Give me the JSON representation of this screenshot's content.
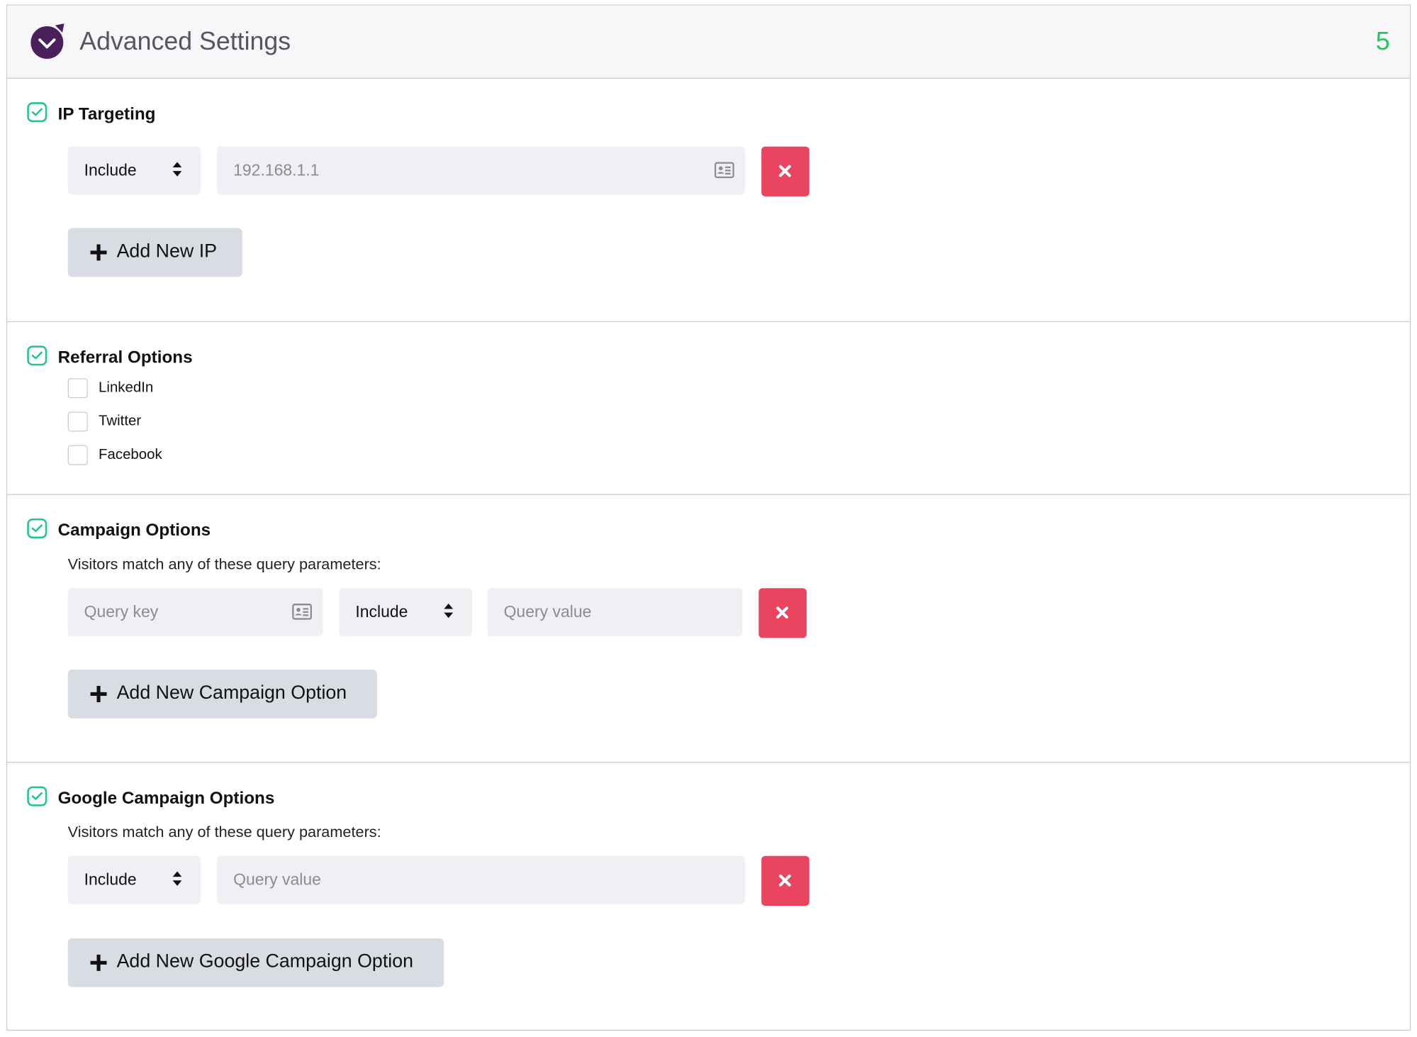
{
  "header": {
    "title": "Advanced Settings",
    "step_number": "5",
    "accent_color": "#22c55e",
    "logo_color": "#4a1f5c"
  },
  "ip_targeting": {
    "title": "IP Targeting",
    "enabled": true,
    "mode": "Include",
    "ip_placeholder": "192.168.1.1",
    "ip_value": "",
    "add_label": "Add New IP"
  },
  "referral": {
    "title": "Referral Options",
    "enabled": true,
    "options": [
      {
        "label": "LinkedIn",
        "checked": false
      },
      {
        "label": "Twitter",
        "checked": false
      },
      {
        "label": "Facebook",
        "checked": false
      }
    ]
  },
  "campaign": {
    "title": "Campaign Options",
    "enabled": true,
    "description": "Visitors match any of these query parameters:",
    "key_placeholder": "Query key",
    "mode": "Include",
    "value_placeholder": "Query value",
    "add_label": "Add New Campaign Option"
  },
  "google_campaign": {
    "title": "Google Campaign Options",
    "enabled": true,
    "description": "Visitors match any of these query parameters:",
    "mode": "Include",
    "value_placeholder": "Query value",
    "add_label": "Add New Google Campaign Option"
  },
  "colors": {
    "delete_button": "#e94560",
    "check_green": "#22c58a",
    "add_button_bg": "#d9dce3",
    "field_bg": "#eef0f4"
  }
}
